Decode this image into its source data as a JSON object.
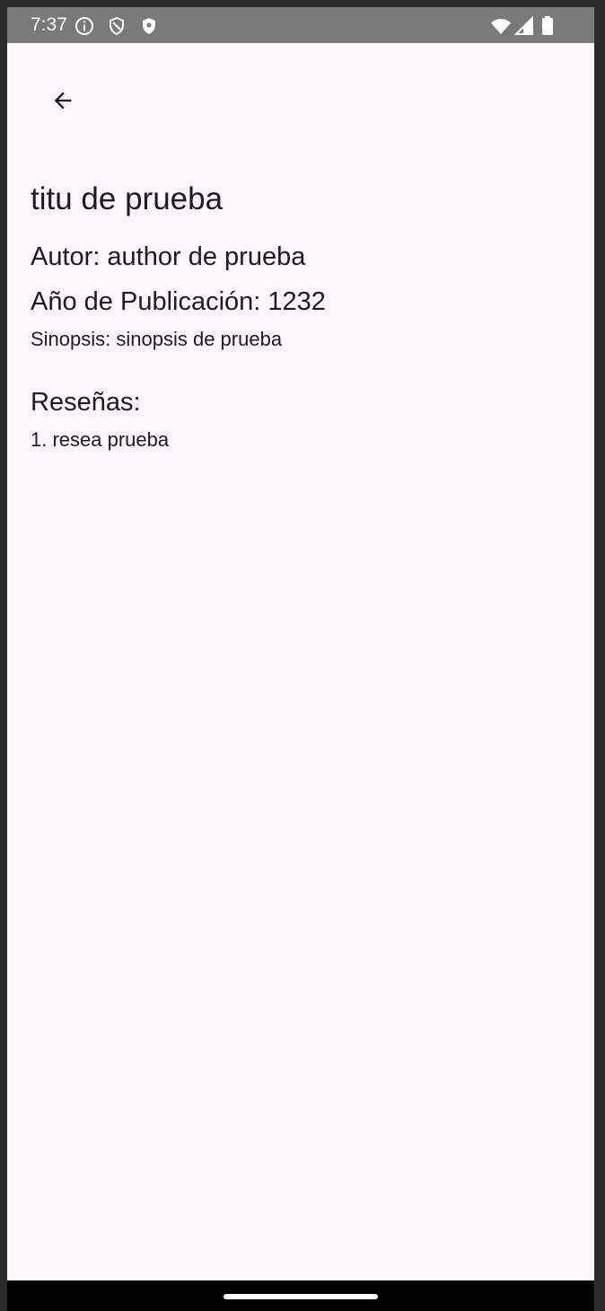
{
  "status_bar": {
    "time": "7:37",
    "icons_left": [
      "info-circle-icon",
      "vpn-shield-icon",
      "shield-security-icon"
    ],
    "icons_right": [
      "wifi-icon",
      "signal-icon",
      "battery-icon"
    ],
    "background": "#7a7a7a"
  },
  "toolbar": {
    "back_icon": "arrow-back-icon"
  },
  "book": {
    "title": "titu de prueba",
    "author": "Autor: author de prueba",
    "year": "Año de Publicación: 1232",
    "synopsis": "Sinopsis: sinopsis de prueba"
  },
  "reviews": {
    "heading": "Reseñas:",
    "items": [
      "1. resea prueba"
    ]
  },
  "colors": {
    "surface": "#fef7fb",
    "on_surface": "#1d1b20",
    "system_bar": "#000000"
  }
}
